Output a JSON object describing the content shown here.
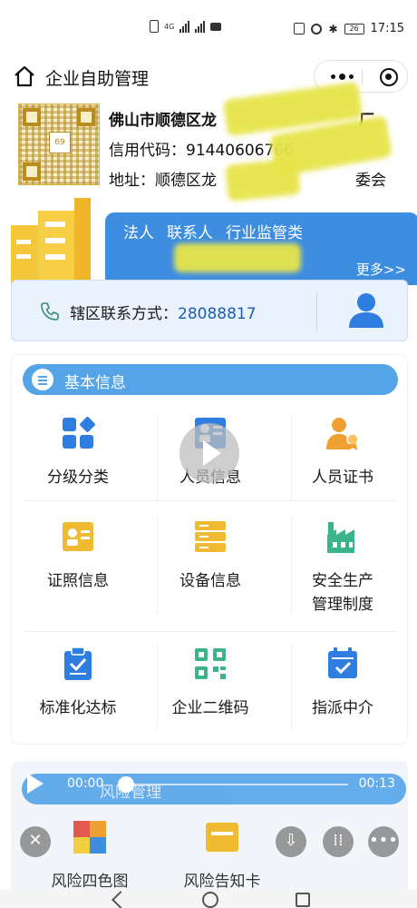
{
  "status_bar": {
    "time": "17:15",
    "battery": "26",
    "network": "4G"
  },
  "nav": {
    "title": "企业自助管理"
  },
  "company": {
    "name_start": "佛山市顺德区龙",
    "name_end": "厂",
    "credit_label": "信用代码：",
    "credit_value": "91440606766",
    "address_label": "地址：",
    "address_value": "顺德区龙",
    "address_tail": "委会"
  },
  "banner": {
    "tabs": [
      "法人",
      "联系人",
      "行业监管类"
    ],
    "more": "更多>>"
  },
  "contact": {
    "label": "辖区联系方式：",
    "value": "28088817"
  },
  "basic_info": {
    "title": "基本信息",
    "items": [
      {
        "label": "分级分类",
        "icon": "grid-classify-icon"
      },
      {
        "label": "人员信息",
        "icon": "id-card-icon"
      },
      {
        "label": "人员证书",
        "icon": "certificate-person-icon"
      },
      {
        "label": "证照信息",
        "icon": "license-card-icon"
      },
      {
        "label": "设备信息",
        "icon": "equipment-icon"
      },
      {
        "label": "安全生产管理制度",
        "label_line1": "安全生产",
        "label_line2": "管理制度",
        "icon": "factory-icon"
      },
      {
        "label": "标准化达标",
        "icon": "clipboard-check-icon"
      },
      {
        "label": "企业二维码",
        "icon": "qr-code-icon"
      },
      {
        "label": "指派中介",
        "icon": "calendar-check-icon"
      }
    ]
  },
  "risk": {
    "title": "风险管理",
    "items": [
      {
        "label": "风险四色图",
        "icon": "four-color-map-icon"
      },
      {
        "label": "风险告知卡",
        "icon": "notice-card-icon"
      }
    ]
  },
  "audio": {
    "current": "00:00",
    "total": "00:13"
  },
  "colors": {
    "accent": "#55a4e8",
    "banner_blue": "#3d8de0",
    "icon_yellow": "#f0bb33",
    "icon_blue": "#2e7de0",
    "icon_green": "#3bb38d"
  }
}
